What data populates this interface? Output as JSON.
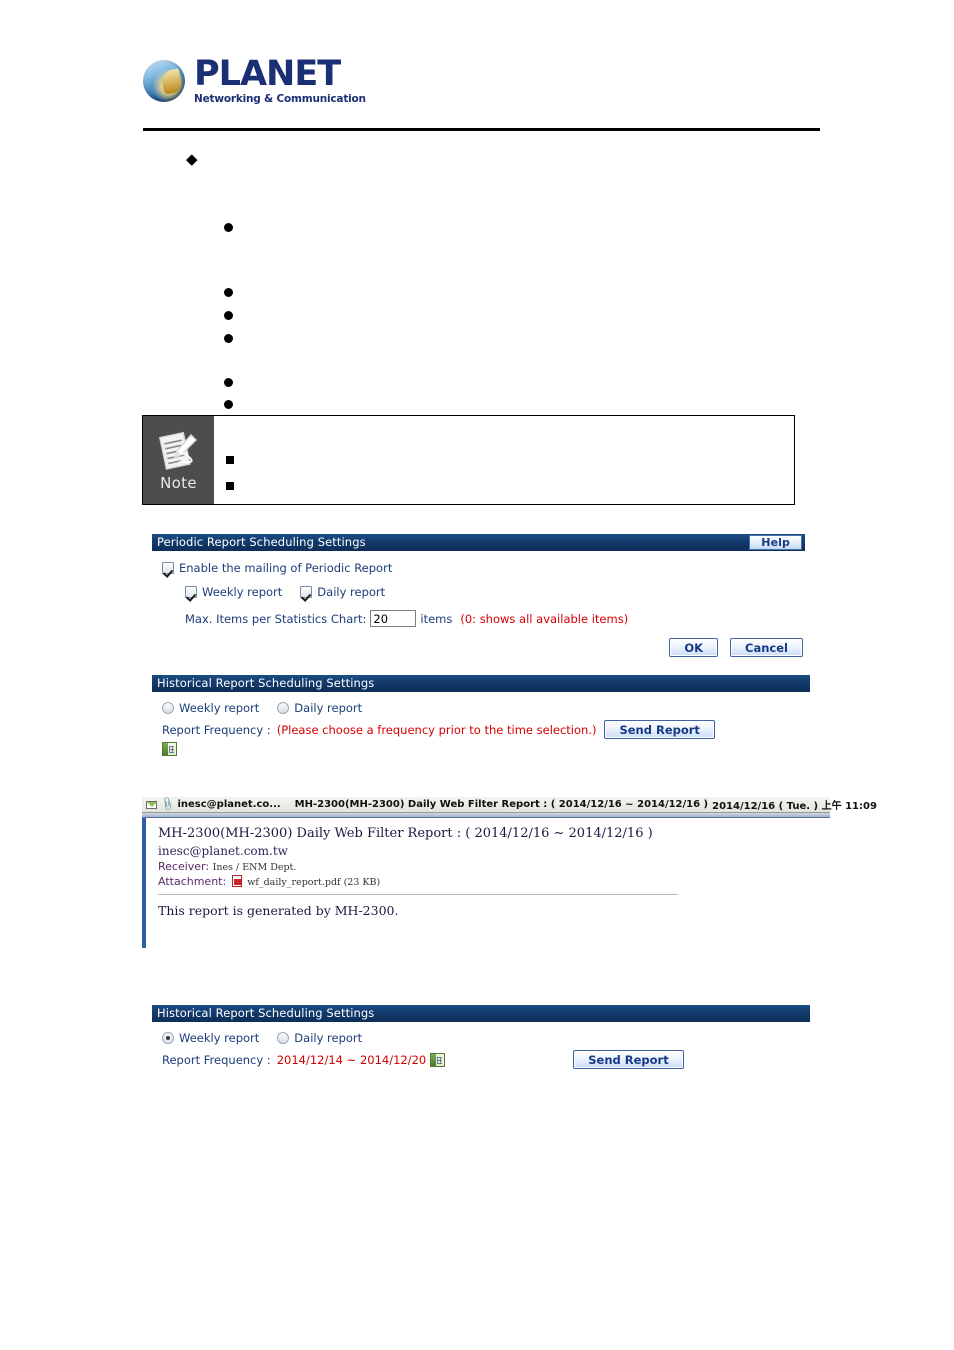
{
  "brand": {
    "name": "PLANET",
    "tagline": "Networking & Communication",
    "logo_icon": "planet-globe-logo"
  },
  "note_box": {
    "label": "Note",
    "icon": "note-pencil-paper-icon",
    "bullets": [
      "",
      ""
    ]
  },
  "periodic_panel": {
    "title": "Periodic Report Scheduling Settings",
    "help_label": "Help",
    "enable_label": "Enable the mailing of Periodic Report",
    "enable_checked": true,
    "weekly_label": "Weekly report",
    "weekly_checked": true,
    "daily_label": "Daily report",
    "daily_checked": true,
    "max_items_label": "Max. Items per Statistics Chart:",
    "max_items_value": "20",
    "items_unit": "items",
    "items_hint": "(0: shows all available items)",
    "ok_label": "OK",
    "cancel_label": "Cancel",
    "hint_color": "#d40000",
    "title_color": "#123a6b"
  },
  "historical_panel_empty": {
    "title": "Historical Report Scheduling Settings",
    "weekly_label": "Weekly report",
    "weekly_selected": false,
    "daily_label": "Daily report",
    "daily_selected": false,
    "frequency_label": "Report Frequency :",
    "frequency_value": "(Please choose a frequency prior to the time selection.)",
    "calendar_icon": "calendar-icon",
    "send_label": "Send Report"
  },
  "historical_panel_filled": {
    "title": "Historical Report Scheduling Settings",
    "weekly_label": "Weekly report",
    "weekly_selected": true,
    "daily_label": "Daily report",
    "daily_selected": false,
    "frequency_label": "Report Frequency :",
    "frequency_value": "2014/12/14 ~ 2014/12/20",
    "calendar_icon": "calendar-icon",
    "send_label": "Send Report"
  },
  "mail": {
    "envelope_icon": "envelope-icon",
    "attachment_icon": "paperclip-icon",
    "from_short": "inesc@planet.co...",
    "subject_bar": "MH-2300(MH-2300) Daily Web Filter Report : ( 2014/12/16 ~ 2014/12/16 )",
    "received_date": "2014/12/16 ( Tue. ) 上午 11:09",
    "subject": "MH-2300(MH-2300) Daily Web Filter Report : ( 2014/12/16 ~ 2014/12/16 )",
    "sender_address": "inesc@planet.com.tw",
    "receiver_label": "Receiver:",
    "receiver_value": "Ines / ENM Dept.",
    "attachment_label": "Attachment:",
    "attachment_name": "wf_daily_report.pdf (23 KB)",
    "attachment_file_icon": "pdf-file-icon",
    "body": "This report is generated by MH-2300."
  }
}
